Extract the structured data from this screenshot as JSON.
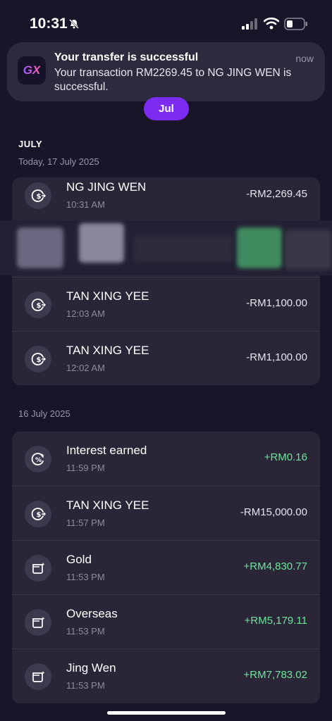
{
  "status_bar": {
    "time": "10:31"
  },
  "notification": {
    "app_logo_text": "GX",
    "title": "Your transfer is successful",
    "time": "now",
    "body": "Your transaction RM2269.45 to NG JING WEN is successful."
  },
  "month_pill": {
    "label": "Jul"
  },
  "month_header": "JULY",
  "groups": [
    {
      "date": "Today, 17 July 2025",
      "items": [
        {
          "name": "NG JING WEN",
          "time": "10:31 AM",
          "amount": "-RM2,269.45",
          "positive": false,
          "icon": "transfer-icon"
        },
        {
          "name": "TAN XING YEE",
          "time": "12:03 AM",
          "amount": "-RM1,100.00",
          "positive": false,
          "icon": "transfer-icon"
        },
        {
          "name": "TAN XING YEE",
          "time": "12:02 AM",
          "amount": "-RM1,100.00",
          "positive": false,
          "icon": "transfer-icon"
        }
      ]
    },
    {
      "date": "16 July 2025",
      "items": [
        {
          "name": "Interest earned",
          "time": "11:59 PM",
          "amount": "+RM0.16",
          "positive": true,
          "icon": "interest-icon"
        },
        {
          "name": "TAN XING YEE",
          "time": "11:57 PM",
          "amount": "-RM15,000.00",
          "positive": false,
          "icon": "transfer-icon"
        },
        {
          "name": "Gold",
          "time": "11:53 PM",
          "amount": "+RM4,830.77",
          "positive": true,
          "icon": "pocket-icon"
        },
        {
          "name": "Overseas",
          "time": "11:53 PM",
          "amount": "+RM5,179.11",
          "positive": true,
          "icon": "pocket-icon"
        },
        {
          "name": "Jing Wen",
          "time": "11:53 PM",
          "amount": "+RM7,783.02",
          "positive": true,
          "icon": "pocket-icon"
        }
      ]
    }
  ],
  "colors": {
    "background": "#191428",
    "card": "#2a2638",
    "accent": "#7b2cf0",
    "positive": "#6ee49a"
  }
}
